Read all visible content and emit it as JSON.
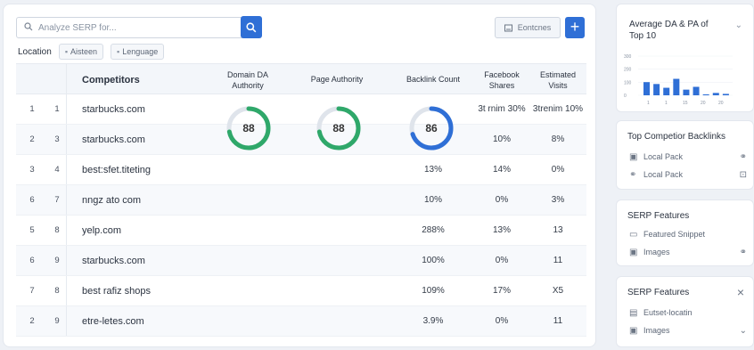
{
  "toolbar": {
    "search_placeholder": "Analyze SERP for...",
    "tool_label": "Eontcnes",
    "add_label": "+"
  },
  "filters": {
    "location_label": "Location",
    "chips": [
      "Aisteen",
      "Lenguage"
    ]
  },
  "table": {
    "headers": {
      "competitors": "Competitors",
      "domain": "Domain DA Authority",
      "page": "Page Authority",
      "backlink": "Backlink Count",
      "facebook": "Facebook Shares",
      "visits": "Estimated Visits"
    },
    "rows": [
      {
        "rank": "1",
        "pos": "1",
        "domain": "starbucks.com",
        "backlink": "",
        "facebook": "3t rnim 30%",
        "visits": "3trenim 10%"
      },
      {
        "rank": "2",
        "pos": "3",
        "domain": "starbucks.com",
        "backlink": "",
        "facebook": "10%",
        "visits": "8%"
      },
      {
        "rank": "3",
        "pos": "4",
        "domain": "best:sfet.titeting",
        "backlink": "13%",
        "facebook": "14%",
        "visits": "0%"
      },
      {
        "rank": "6",
        "pos": "7",
        "domain": "nngz ato com",
        "backlink": "10%",
        "facebook": "0%",
        "visits": "3%"
      },
      {
        "rank": "5",
        "pos": "8",
        "domain": "yelp.com",
        "backlink": "288%",
        "facebook": "13%",
        "visits": "13"
      },
      {
        "rank": "6",
        "pos": "9",
        "domain": "starbucks.com",
        "backlink": "100%",
        "facebook": "0%",
        "visits": "11"
      },
      {
        "rank": "7",
        "pos": "8",
        "domain": "best rafiz shops",
        "backlink": "109%",
        "facebook": "17%",
        "visits": "X5"
      },
      {
        "rank": "2",
        "pos": "9",
        "domain": "etre-letes.com",
        "backlink": "3.9%",
        "facebook": "0%",
        "visits": "11"
      }
    ],
    "gauges": [
      {
        "value": "88",
        "color": "#2fa86a",
        "fraction": 0.72
      },
      {
        "value": "88",
        "color": "#2fa86a",
        "fraction": 0.72
      },
      {
        "value": "86",
        "color": "#2f6fd6",
        "fraction": 0.7
      }
    ]
  },
  "side": {
    "chart": {
      "title": "Average DA & PA of Top 10",
      "chart_data": {
        "type": "bar",
        "categories": [
          "1",
          "",
          "10",
          "",
          "15",
          "",
          "20",
          "",
          "30"
        ],
        "values": [
          28,
          24,
          16,
          35,
          12,
          18,
          2,
          5,
          3
        ],
        "ylim": [
          0,
          100
        ],
        "yticks": [
          "300",
          "200",
          "100",
          "0"
        ],
        "xticks": [
          "1",
          "1",
          "15",
          "20",
          "20"
        ],
        "color": "#2f6fd6"
      }
    },
    "backlinks": {
      "title": "Top Competior Backlinks",
      "items": [
        {
          "label": "Local Pack",
          "icon": "document-icon",
          "right_icon": "link-icon"
        },
        {
          "label": "Local Pack",
          "icon": "link-icon",
          "right_icon": "export-icon"
        }
      ]
    },
    "serp1": {
      "title": "SERP Features",
      "items": [
        {
          "label": "Featured Snippet",
          "icon": "snippet-icon",
          "right_icon": ""
        },
        {
          "label": "Images",
          "icon": "image-icon",
          "right_icon": "link-icon"
        }
      ]
    },
    "serp2": {
      "title": "SERP Features",
      "close": "×",
      "items": [
        {
          "label": "Eutset-locatin",
          "icon": "calendar-icon",
          "right_icon": ""
        },
        {
          "label": "Images",
          "icon": "image-icon",
          "right_icon": "dropdown-icon"
        }
      ]
    }
  }
}
